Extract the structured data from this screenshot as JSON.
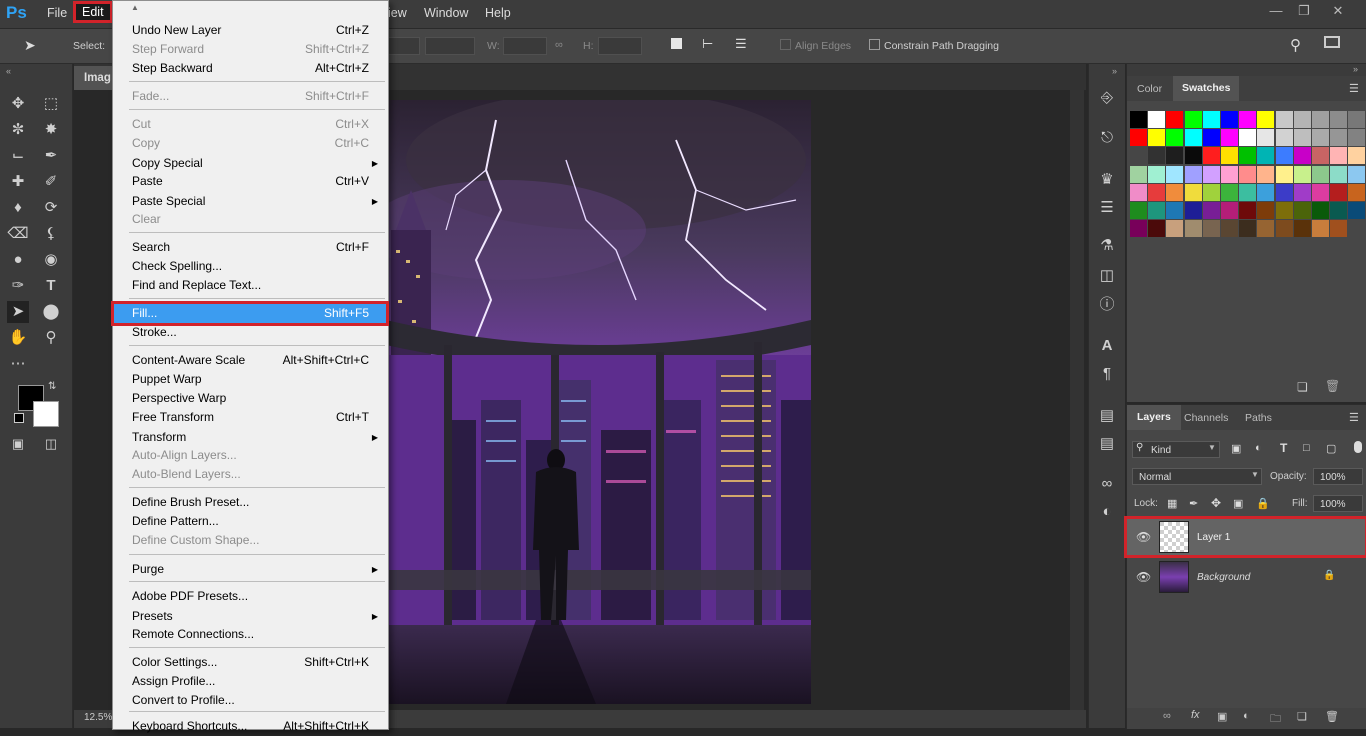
{
  "app": {
    "logo": "Ps",
    "title": "Adobe Photoshop"
  },
  "menubar": {
    "items": [
      {
        "label": "File"
      },
      {
        "label": "Edit"
      },
      {
        "label": "iew"
      },
      {
        "label": "Window"
      },
      {
        "label": "Help"
      }
    ],
    "active": "Edit"
  },
  "options_bar": {
    "select_label": "Select:",
    "w_label": "W:",
    "h_label": "H:",
    "align_edges_label": "Align Edges",
    "constrain_label": "Constrain Path Dragging"
  },
  "document": {
    "tab_label": "Imag",
    "zoom": "12.5%"
  },
  "edit_menu": {
    "items": [
      {
        "label": "Undo New Layer",
        "shortcut": "Ctrl+Z",
        "enabled": true
      },
      {
        "label": "Step Forward",
        "shortcut": "Shift+Ctrl+Z",
        "enabled": false
      },
      {
        "label": "Step Backward",
        "shortcut": "Alt+Ctrl+Z",
        "enabled": true
      },
      {
        "label": "Fade...",
        "shortcut": "Shift+Ctrl+F",
        "enabled": false
      },
      {
        "label": "Cut",
        "shortcut": "Ctrl+X",
        "enabled": false
      },
      {
        "label": "Copy",
        "shortcut": "Ctrl+C",
        "enabled": false
      },
      {
        "label": "Copy Special",
        "shortcut": "",
        "enabled": true,
        "submenu": true
      },
      {
        "label": "Paste",
        "shortcut": "Ctrl+V",
        "enabled": true
      },
      {
        "label": "Paste Special",
        "shortcut": "",
        "enabled": true,
        "submenu": true
      },
      {
        "label": "Clear",
        "shortcut": "",
        "enabled": false
      },
      {
        "label": "Search",
        "shortcut": "Ctrl+F",
        "enabled": true
      },
      {
        "label": "Check Spelling...",
        "shortcut": "",
        "enabled": true
      },
      {
        "label": "Find and Replace Text...",
        "shortcut": "",
        "enabled": true
      },
      {
        "label": "Fill...",
        "shortcut": "Shift+F5",
        "enabled": true,
        "highlighted": true
      },
      {
        "label": "Stroke...",
        "shortcut": "",
        "enabled": true
      },
      {
        "label": "Content-Aware Scale",
        "shortcut": "Alt+Shift+Ctrl+C",
        "enabled": true
      },
      {
        "label": "Puppet Warp",
        "shortcut": "",
        "enabled": true
      },
      {
        "label": "Perspective Warp",
        "shortcut": "",
        "enabled": true
      },
      {
        "label": "Free Transform",
        "shortcut": "Ctrl+T",
        "enabled": true
      },
      {
        "label": "Transform",
        "shortcut": "",
        "enabled": true,
        "submenu": true
      },
      {
        "label": "Auto-Align Layers...",
        "shortcut": "",
        "enabled": false
      },
      {
        "label": "Auto-Blend Layers...",
        "shortcut": "",
        "enabled": false
      },
      {
        "label": "Define Brush Preset...",
        "shortcut": "",
        "enabled": true
      },
      {
        "label": "Define Pattern...",
        "shortcut": "",
        "enabled": true
      },
      {
        "label": "Define Custom Shape...",
        "shortcut": "",
        "enabled": false
      },
      {
        "label": "Purge",
        "shortcut": "",
        "enabled": true,
        "submenu": true
      },
      {
        "label": "Adobe PDF Presets...",
        "shortcut": "",
        "enabled": true
      },
      {
        "label": "Presets",
        "shortcut": "",
        "enabled": true,
        "submenu": true
      },
      {
        "label": "Remote Connections...",
        "shortcut": "",
        "enabled": true
      },
      {
        "label": "Color Settings...",
        "shortcut": "Shift+Ctrl+K",
        "enabled": true
      },
      {
        "label": "Assign Profile...",
        "shortcut": "",
        "enabled": true
      },
      {
        "label": "Convert to Profile...",
        "shortcut": "",
        "enabled": true
      },
      {
        "label": "Keyboard Shortcuts...",
        "shortcut": "Alt+Shift+Ctrl+K",
        "enabled": true
      }
    ]
  },
  "swatches_panel": {
    "tabs": [
      {
        "label": "Color"
      },
      {
        "label": "Swatches"
      }
    ],
    "active_tab": "Swatches",
    "colors": [
      "#000000",
      "#ffffff",
      "#ff0000",
      "#00ff00",
      "#00ffff",
      "#0000ff",
      "#ff00ff",
      "#ffff00",
      "#c8c8c8",
      "#b4b4b4",
      "#a0a0a0",
      "#8c8c8c",
      "#787878",
      "#646464",
      "#f0f0b4",
      "#ff0000",
      "#ffff00",
      "#00ff00",
      "#00ffff",
      "#0000ff",
      "#ff00ff",
      "#ffffff",
      "#e6e6e6",
      "#d2d2d2",
      "#bebebe",
      "#aaaaaa",
      "#969696",
      "#828282",
      "#6e6e6e",
      "#5a5a5a",
      "#464646",
      "#323232",
      "#1e1e1e",
      "#0a0a0a",
      "#ff1e1e",
      "#ffe000",
      "#00c000",
      "#00b4b4",
      "#3c7cff",
      "#c800c8",
      "#c86464",
      "#ffb4b4",
      "#ffd2a0",
      "#fff0a0",
      "#d2f0a0",
      "#a0d2a0",
      "#a0f0d2",
      "#a0e6ff",
      "#a0a0ff",
      "#d2a0ff",
      "#ffa0d2",
      "#ff8c8c",
      "#ffb48c",
      "#fff08c",
      "#c8f08c",
      "#8cc88c",
      "#8cdcc8",
      "#8cc8f0",
      "#8c8cdc",
      "#c88cdc",
      "#f08cc8",
      "#e63c3c",
      "#f08c3c",
      "#f0dc3c",
      "#a0d23c",
      "#3cb43c",
      "#3cbea0",
      "#3ca0dc",
      "#3c3cc8",
      "#a03cc8",
      "#dc3ca0",
      "#b41e1e",
      "#c8641e",
      "#c8b41e",
      "#78a01e",
      "#1e8c1e",
      "#1e967d",
      "#1e78b4",
      "#1e1e96",
      "#781e96",
      "#b41e78",
      "#6e0a0a",
      "#7d3c0a",
      "#7d6e0a",
      "#4b640a",
      "#0a5a0a",
      "#0a5a50",
      "#0a4b78",
      "#0a0a5a",
      "#4b0a5a",
      "#78005a",
      "#4b0a0a",
      "#c8a07d",
      "#a08c6e",
      "#786450",
      "#5a4632",
      "#3c2d1e",
      "#966432",
      "#7d4b1e",
      "#5a320a",
      "#c87d3c",
      "#a0501e"
    ]
  },
  "layers_panel": {
    "tabs": [
      {
        "label": "Layers"
      },
      {
        "label": "Channels"
      },
      {
        "label": "Paths"
      }
    ],
    "active_tab": "Layers",
    "filter_label": "Kind",
    "blend_mode": "Normal",
    "opacity_label": "Opacity:",
    "opacity_value": "100%",
    "lock_label": "Lock:",
    "fill_label": "Fill:",
    "fill_value": "100%",
    "layers": [
      {
        "name": "Layer 1",
        "selected": true,
        "visible": true,
        "locked": false
      },
      {
        "name": "Background",
        "selected": false,
        "visible": true,
        "locked": true
      }
    ]
  },
  "colors": {
    "menubar_bg": "#3c3c3c",
    "panel_bg": "#474747",
    "highlight_blue": "#3c9cf0",
    "annotation_red": "#d2232a",
    "foreground": "#000000",
    "background": "#ffffff"
  }
}
